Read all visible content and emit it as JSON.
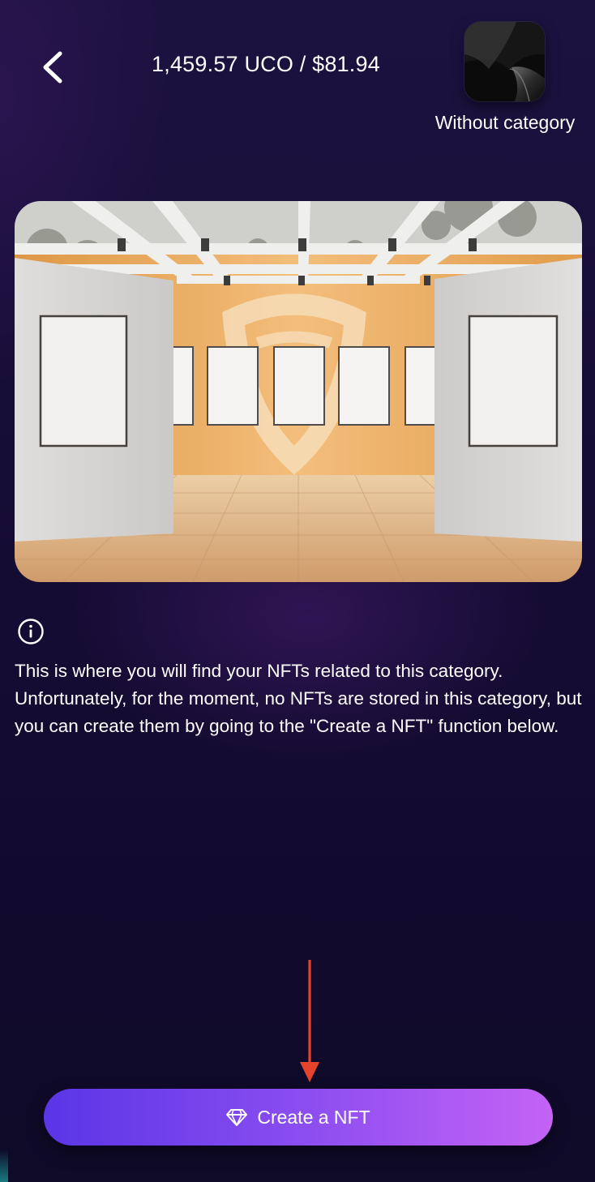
{
  "header": {
    "balance": "1,459.57 UCO / $81.94",
    "back_icon": "chevron-left-icon"
  },
  "category": {
    "label": "Without category",
    "thumbnail_colors": [
      "#4a4a4a",
      "#050505"
    ]
  },
  "info": {
    "icon": "info-icon",
    "message": "This is where you will find your NFTs related to this category. Unfortunately, for the moment, no NFTs are stored in this category, but you can create them by going to the \"Create a NFT\" function below."
  },
  "create_button": {
    "label": "Create a NFT",
    "icon": "diamond-icon",
    "gradient": [
      "#5a35e6",
      "#c463f5"
    ]
  },
  "annotation": {
    "arrow_color": "#e5432b"
  }
}
